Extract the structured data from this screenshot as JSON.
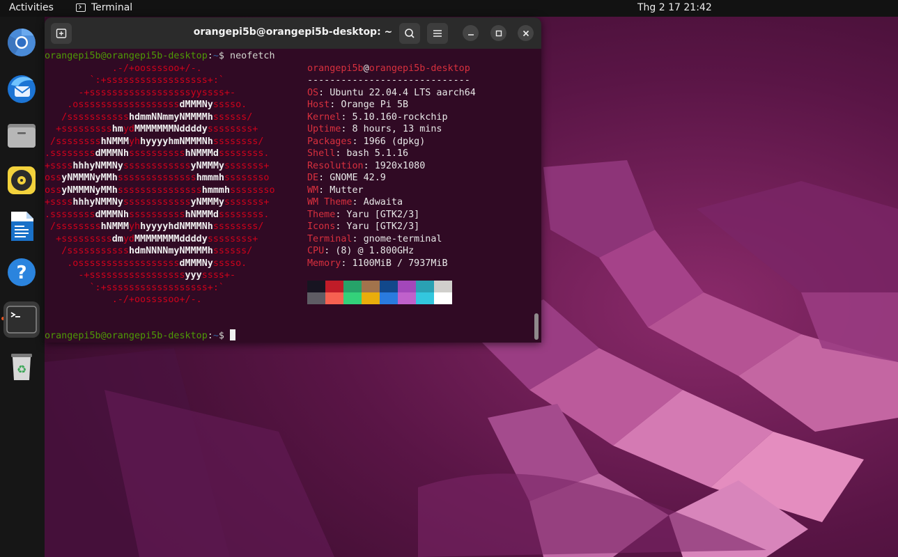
{
  "topbar": {
    "activities": "Activities",
    "app_name": "Terminal",
    "clock": "Thg 2 17  21:42"
  },
  "dock": {
    "items": [
      {
        "name": "Chromium",
        "icon": "chromium-icon"
      },
      {
        "name": "Thunderbird",
        "icon": "thunderbird-icon"
      },
      {
        "name": "Files",
        "icon": "files-icon"
      },
      {
        "name": "Rhythmbox",
        "icon": "rhythmbox-icon"
      },
      {
        "name": "LibreOffice Writer",
        "icon": "writer-icon"
      },
      {
        "name": "Help",
        "icon": "help-icon"
      },
      {
        "name": "Terminal",
        "icon": "terminal-icon",
        "active": true
      },
      {
        "name": "Trash",
        "icon": "trash-icon"
      }
    ]
  },
  "terminal": {
    "title": "orangepi5b@orangepi5b-desktop: ~",
    "prompt_user": "orangepi5b@orangepi5b-desktop",
    "prompt_path": "~",
    "prompt_symbol": "$",
    "command": "neofetch",
    "logo_lines": [
      "            .-/+oossssoo+/-.",
      "        `:+ssssssssssssssssss+:`",
      "      -+ssssssssssssssssssyyssss+-",
      "    .ossssssssssssssssss[dMMMNy]sssso.",
      "   /sssssssssss[hdmmNNmmyNMMMMh]ssssss/",
      "  +sssssssss[hm]yd[MMMMMMMNddddy]ssssssss+",
      " /ssssssss[hNMMM]yh[hyyyyhmNMMMNh]ssssssss/",
      ".ssssssss[dMMMNh]ssssssssss[hNMMMd]ssssssss.",
      "+ssss[hhhyNMMNy]ssssssssssss[yNMMMy]sssssss+",
      "oss[yNMMMNyMMh]ssssssssssssss[hmmmh]ssssssso",
      "oss[yNMMMNyMMh]sssssssssssssss[hmmmh]ssssssso",
      "+ssss[hhhyNMMNy]ssssssssssss[yNMMMy]sssssss+",
      ".ssssssss[dMMMNh]ssssssssss[hNMMMd]ssssssss.",
      " /ssssssss[hNMMM]yh[hyyyyhdNMMMNh]ssssssss/",
      "  +sssssssss[dm]yd[MMMMMMMMddddy]ssssssss+",
      "   /sssssssssss[hdmNNNNmyNMMMMh]ssssss/",
      "    .ossssssssssssssssss[dMMMNy]sssso.",
      "      -+sssssssssssssssss[yyy]ssss+-",
      "        `:+ssssssssssssssssss+:`",
      "            .-/+oossssoo+/-."
    ],
    "info_header_user": "orangepi5b",
    "info_header_host": "orangepi5b-desktop",
    "info_separator": "-----------------------------",
    "info": [
      {
        "key": "OS",
        "value": "Ubuntu 22.04.4 LTS aarch64"
      },
      {
        "key": "Host",
        "value": "Orange Pi 5B"
      },
      {
        "key": "Kernel",
        "value": "5.10.160-rockchip"
      },
      {
        "key": "Uptime",
        "value": "8 hours, 13 mins"
      },
      {
        "key": "Packages",
        "value": "1966 (dpkg)"
      },
      {
        "key": "Shell",
        "value": "bash 5.1.16"
      },
      {
        "key": "Resolution",
        "value": "1920x1080"
      },
      {
        "key": "DE",
        "value": "GNOME 42.9"
      },
      {
        "key": "WM",
        "value": "Mutter"
      },
      {
        "key": "WM Theme",
        "value": "Adwaita"
      },
      {
        "key": "Theme",
        "value": "Yaru [GTK2/3]"
      },
      {
        "key": "Icons",
        "value": "Yaru [GTK2/3]"
      },
      {
        "key": "Terminal",
        "value": "gnome-terminal"
      },
      {
        "key": "CPU",
        "value": "(8) @ 1.800GHz"
      },
      {
        "key": "Memory",
        "value": "1100MiB / 7937MiB"
      }
    ],
    "palette_row1": [
      "#171421",
      "#c01c28",
      "#26a269",
      "#a2734c",
      "#12488b",
      "#a347ba",
      "#2aa1b3",
      "#d0cfcc"
    ],
    "palette_row2": [
      "#5e5c64",
      "#f66151",
      "#33d17a",
      "#e9ad0c",
      "#2a7bde",
      "#c061cb",
      "#33c7de",
      "#ffffff"
    ]
  },
  "colors": {
    "terminal_bg": "#300a24",
    "prompt_user": "#4e9a06",
    "prompt_path": "#3465a4",
    "accent": "#d9303e"
  }
}
